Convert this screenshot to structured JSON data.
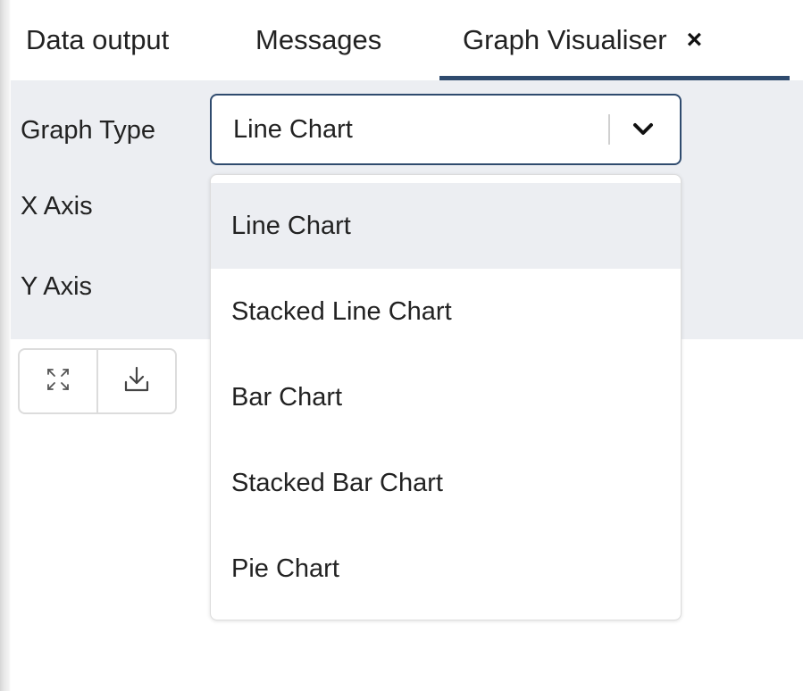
{
  "tabs": [
    {
      "label": "Data output",
      "active": false
    },
    {
      "label": "Messages",
      "active": false
    },
    {
      "label": "Graph Visualiser",
      "active": true,
      "close_glyph": "×",
      "close_icon": "close-icon"
    }
  ],
  "form": {
    "graph_type_label": "Graph Type",
    "x_axis_label": "X Axis",
    "y_axis_label": "Y Axis",
    "graph_type_value": "Line Chart",
    "dropdown_icon": "chevron-down-icon"
  },
  "dropdown": {
    "selected_index": 0,
    "options": [
      "Line Chart",
      "Stacked Line Chart",
      "Bar Chart",
      "Stacked Bar Chart",
      "Pie Chart"
    ]
  },
  "toolbar": {
    "buttons": [
      {
        "icon": "expand-icon"
      },
      {
        "icon": "download-icon"
      }
    ]
  },
  "colors": {
    "accent": "#2f4b6e",
    "panel_bg": "#eceef2",
    "border": "#dcdcdc"
  }
}
